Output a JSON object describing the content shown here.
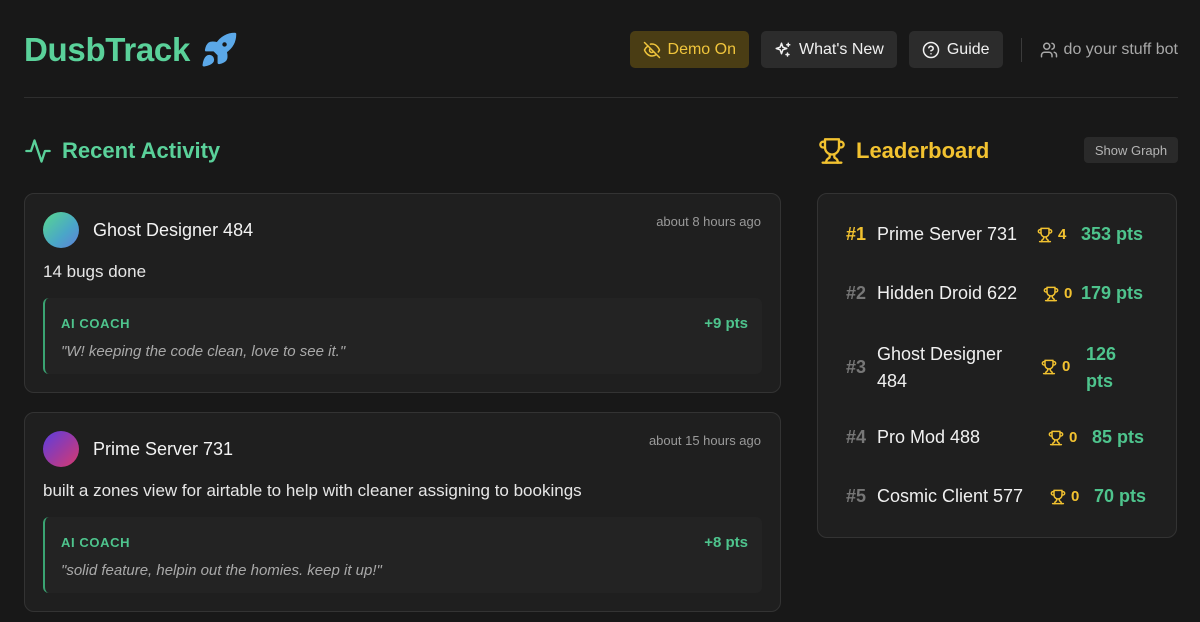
{
  "app": {
    "title": "DusbTrack",
    "brand_icon": "rocket-icon",
    "accent_color": "#5ad19a"
  },
  "nav": {
    "demo_label": "Demo On",
    "whats_new_label": "What's New",
    "guide_label": "Guide",
    "user_name": "do your stuff bot"
  },
  "activity": {
    "title": "Recent Activity",
    "items": [
      {
        "user": "Ghost Designer 484",
        "time": "about 8 hours ago",
        "text": "14 bugs done",
        "coach_label": "AI COACH",
        "coach_points": "+9 pts",
        "coach_quote": "\"W! keeping the code clean, love to see it.\""
      },
      {
        "user": "Prime Server 731",
        "time": "about 15 hours ago",
        "text": "built a zones view for airtable to help with cleaner assigning to bookings",
        "coach_label": "AI COACH",
        "coach_points": "+8 pts",
        "coach_quote": "\"solid feature, helpin out the homies. keep it up!\""
      }
    ]
  },
  "leaderboard": {
    "title": "Leaderboard",
    "show_graph_label": "Show Graph",
    "rows": [
      {
        "rank": "#1",
        "name": "Prime Server 731",
        "trophies": "4",
        "points": "353 pts"
      },
      {
        "rank": "#2",
        "name": "Hidden Droid 622",
        "trophies": "0",
        "points": "179 pts"
      },
      {
        "rank": "#3",
        "name": "Ghost Designer 484",
        "trophies": "0",
        "points": "126 pts"
      },
      {
        "rank": "#4",
        "name": "Pro Mod 488",
        "trophies": "0",
        "points": "85 pts"
      },
      {
        "rank": "#5",
        "name": "Cosmic Client 577",
        "trophies": "0",
        "points": "70 pts"
      }
    ]
  }
}
